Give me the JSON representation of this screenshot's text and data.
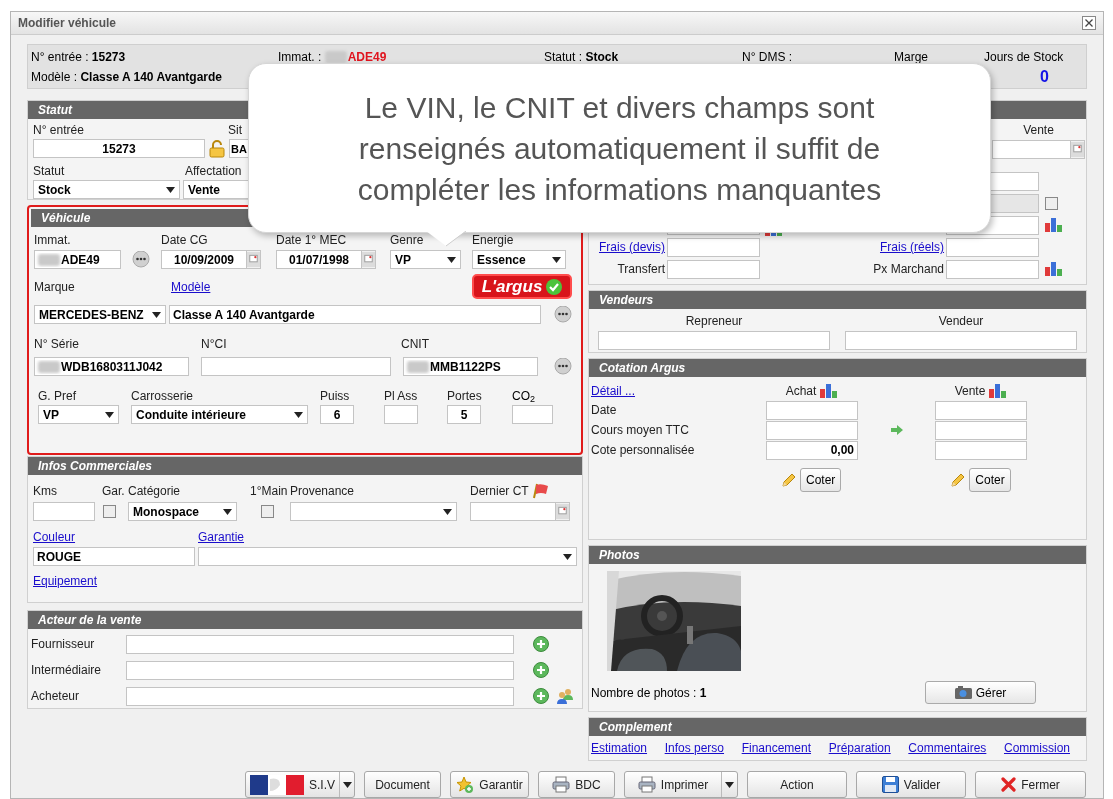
{
  "window": {
    "title": "Modifier véhicule"
  },
  "summary": {
    "entry_label": "N° entrée :",
    "entry_value": "15273",
    "plate_label": "Immat. :",
    "plate_value": "ADE49",
    "plate_redacted": true,
    "status_label": "Statut :",
    "status_value": "Stock",
    "dms_label": "N° DMS :",
    "margin_label": "Marge",
    "stock_days_label": "Jours de Stock",
    "stock_days_value": "0",
    "model_label": "Modèle :",
    "model_value": "Classe A 140 Avantgarde"
  },
  "callout": {
    "lines": [
      "Le VIN, le CNIT et divers champs sont",
      "renseignés automatiquement il suffit de",
      "compléter les informations manquantes"
    ]
  },
  "statut": {
    "title": "Statut",
    "entry_label": "N° entrée",
    "entry_value": "15273",
    "site_label": "Sit",
    "site_value": "BA",
    "status_label": "Statut",
    "status_value": "Stock",
    "assignment_label": "Affectation",
    "assignment_value": "Vente"
  },
  "vehicle": {
    "title": "Véhicule",
    "highlighted": true,
    "plate": {
      "label": "Immat.",
      "value": "ADE49",
      "redacted": true
    },
    "date_cg": {
      "label": "Date CG",
      "value": "10/09/2009"
    },
    "date_mec": {
      "label": "Date 1° MEC",
      "value": "01/07/1998"
    },
    "genre": {
      "label": "Genre",
      "value": "VP"
    },
    "energy": {
      "label": "Energie",
      "value": "Essence"
    },
    "brand_label": "Marque",
    "model_link": "Modèle",
    "badge": "L'argus",
    "brand": "MERCEDES-BENZ",
    "model": "Classe A 140 Avantgarde",
    "serial": {
      "label": "N° Série",
      "value": "WDB1680311J042",
      "redacted": true
    },
    "ci": {
      "label": "N°CI"
    },
    "cnit": {
      "label": "CNIT",
      "value": "MMB1122PS",
      "redacted": true
    },
    "pref": {
      "label": "G. Pref",
      "value": "VP"
    },
    "body": {
      "label": "Carrosserie",
      "value": "Conduite intérieure"
    },
    "power": {
      "label": "Puiss",
      "value": "6"
    },
    "seats": {
      "label": "Pl Ass"
    },
    "doors": {
      "label": "Portes",
      "value": "5"
    },
    "co2": {
      "label": "CO$_{2}$"
    }
  },
  "commercial": {
    "title": "Infos Commerciales",
    "kms_label": "Kms",
    "warranty": {
      "label": "Gar.",
      "checked": false
    },
    "category": {
      "label": "Catégorie",
      "value": "Monospace"
    },
    "first_hand": {
      "label": "1°Main",
      "checked": false
    },
    "origin_label": "Provenance",
    "last_ct_label": "Dernier CT",
    "color_link": "Couleur",
    "color_value": "ROUGE",
    "guarantee_link": "Garantie",
    "equipment_link": "Equipement"
  },
  "actors": {
    "title": "Acteur de la vente",
    "rows": [
      {
        "label": "Fournisseur",
        "contacts": false
      },
      {
        "label": "Intermédiaire",
        "contacts": false
      },
      {
        "label": "Acheteur",
        "contacts": true
      }
    ]
  },
  "prices": {
    "sale_label": "Vente",
    "option_checked": false,
    "fees_quote_link": "Frais (devis)",
    "fees_actual_link": "Frais (réels)",
    "transfer_label": "Transfert",
    "dealer_price_label": "Px Marchand"
  },
  "sellers": {
    "title": "Vendeurs",
    "columns": [
      "Repreneur",
      "Vendeur"
    ]
  },
  "argus": {
    "title": "Cotation Argus",
    "detail_link": "Détail ...",
    "buy_label": "Achat",
    "sell_label": "Vente",
    "rows": [
      {
        "label": "Date",
        "arrow": false
      },
      {
        "label": "Cours moyen TTC",
        "arrow": true
      },
      {
        "label": "Cote personnalisée",
        "arrow": false,
        "buy_value": "0,00"
      }
    ],
    "rate_buttons": [
      "Coter",
      "Coter"
    ]
  },
  "photos": {
    "title": "Photos",
    "count_label": "Nombre de photos :",
    "count": "1",
    "manage_button": "Gérer"
  },
  "complement": {
    "title": "Complement",
    "links": [
      "Estimation",
      "Infos perso",
      "Financement",
      "Préparation",
      "Commentaires",
      "Commission"
    ]
  },
  "toolbar": [
    {
      "label": "S.I.V",
      "kind": "siv"
    },
    {
      "label": "Document",
      "kind": "plain"
    },
    {
      "label": "Garantir",
      "kind": "guarantee"
    },
    {
      "label": "BDC",
      "kind": "print"
    },
    {
      "label": "Imprimer",
      "kind": "print_menu"
    },
    {
      "label": "Action",
      "kind": "plain"
    },
    {
      "label": "Valider",
      "kind": "save"
    },
    {
      "label": "Fermer",
      "kind": "close"
    }
  ]
}
